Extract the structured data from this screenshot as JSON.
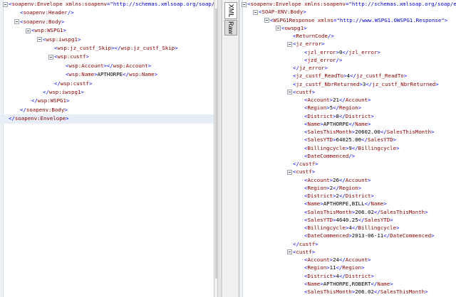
{
  "tabs": {
    "xml": "XML",
    "raw": "Raw"
  },
  "left_lines": [
    {
      "d": 0,
      "f": true,
      "p": [
        [
          "<",
          "p"
        ],
        [
          "soapenv:Envelope",
          "t"
        ],
        [
          " xmlns:soapenv",
          "a"
        ],
        [
          "=",
          "p"
        ],
        [
          "\"http://schemas.xmlsoap.org/soap/envelope/\"",
          "v"
        ],
        [
          ">",
          "p"
        ]
      ]
    },
    {
      "d": 1,
      "f": false,
      "p": [
        [
          "<",
          "p"
        ],
        [
          "soapenv:Header",
          "t"
        ],
        [
          "/>",
          "p"
        ]
      ]
    },
    {
      "d": 1,
      "f": true,
      "p": [
        [
          "<",
          "p"
        ],
        [
          "soapenv:Body",
          "t"
        ],
        [
          ">",
          "p"
        ]
      ]
    },
    {
      "d": 2,
      "f": true,
      "p": [
        [
          "<",
          "p"
        ],
        [
          "wsp:WSPG1",
          "t"
        ],
        [
          ">",
          "p"
        ]
      ]
    },
    {
      "d": 3,
      "f": true,
      "p": [
        [
          "<",
          "p"
        ],
        [
          "wsp:iwspg1",
          "t"
        ],
        [
          ">",
          "p"
        ]
      ]
    },
    {
      "d": 4,
      "f": false,
      "p": [
        [
          "<",
          "p"
        ],
        [
          "wsp:jz_custf_Skip",
          "t"
        ],
        [
          "></",
          "p"
        ],
        [
          "wsp:jz_custf_Skip",
          "t"
        ],
        [
          ">",
          "p"
        ]
      ]
    },
    {
      "d": 4,
      "f": true,
      "p": [
        [
          "<",
          "p"
        ],
        [
          "wsp:custf",
          "t"
        ],
        [
          ">",
          "p"
        ]
      ]
    },
    {
      "d": 5,
      "f": false,
      "p": [
        [
          "<",
          "p"
        ],
        [
          "wsp:Account",
          "t"
        ],
        [
          "></",
          "p"
        ],
        [
          "wsp:Account",
          "t"
        ],
        [
          ">",
          "p"
        ]
      ]
    },
    {
      "d": 5,
      "f": false,
      "p": [
        [
          "<",
          "p"
        ],
        [
          "wsp:Name",
          "t"
        ],
        [
          ">",
          "p"
        ],
        [
          "APTHORPE",
          "x"
        ],
        [
          "</",
          "p"
        ],
        [
          "wsp:Name",
          "t"
        ],
        [
          ">",
          "p"
        ]
      ]
    },
    {
      "d": 4,
      "f": false,
      "p": [
        [
          "</",
          "p"
        ],
        [
          "wsp:custf",
          "t"
        ],
        [
          ">",
          "p"
        ]
      ]
    },
    {
      "d": 3,
      "f": false,
      "p": [
        [
          "</",
          "p"
        ],
        [
          "wsp:iwspg1",
          "t"
        ],
        [
          ">",
          "p"
        ]
      ]
    },
    {
      "d": 2,
      "f": false,
      "p": [
        [
          "</",
          "p"
        ],
        [
          "wsp:WSPG1",
          "t"
        ],
        [
          ">",
          "p"
        ]
      ]
    },
    {
      "d": 1,
      "f": false,
      "p": [
        [
          "</",
          "p"
        ],
        [
          "soapenv:Body",
          "t"
        ],
        [
          ">",
          "p"
        ]
      ]
    },
    {
      "d": 0,
      "f": false,
      "hl": true,
      "p": [
        [
          "</",
          "p"
        ],
        [
          "soapenv:Envelope",
          "t"
        ],
        [
          ">",
          "p"
        ]
      ]
    }
  ],
  "right_lines": [
    {
      "d": 0,
      "f": true,
      "p": [
        [
          "<",
          "p"
        ],
        [
          "soapenv:Envelope",
          "t"
        ],
        [
          " xmlns:soapenv",
          "a"
        ],
        [
          "=",
          "p"
        ],
        [
          "\"http://schemas.xmlsoap.org/soap/envelope/\"",
          "v"
        ],
        [
          ">",
          "p"
        ]
      ]
    },
    {
      "d": 1,
      "f": true,
      "p": [
        [
          "<",
          "p"
        ],
        [
          "SOAP-ENV:Body",
          "t"
        ],
        [
          ">",
          "p"
        ]
      ]
    },
    {
      "d": 2,
      "f": true,
      "p": [
        [
          "<",
          "p"
        ],
        [
          "WSPG1Response",
          "t"
        ],
        [
          " xmlns",
          "a"
        ],
        [
          "=",
          "p"
        ],
        [
          "\"http://www.WSPG1.OWSPG1.Response\"",
          "v"
        ],
        [
          ">",
          "p"
        ]
      ]
    },
    {
      "d": 3,
      "f": true,
      "p": [
        [
          "<",
          "p"
        ],
        [
          "owspg1",
          "t"
        ],
        [
          ">",
          "p"
        ]
      ]
    },
    {
      "d": 4,
      "f": false,
      "p": [
        [
          "<",
          "p"
        ],
        [
          "ReturnCode",
          "t"
        ],
        [
          "/>",
          "p"
        ]
      ]
    },
    {
      "d": 4,
      "f": true,
      "p": [
        [
          "<",
          "p"
        ],
        [
          "jz_error",
          "t"
        ],
        [
          ">",
          "p"
        ]
      ]
    },
    {
      "d": 5,
      "f": false,
      "p": [
        [
          "<",
          "p"
        ],
        [
          "jzl_error",
          "t"
        ],
        [
          ">",
          "p"
        ],
        [
          "0",
          "x"
        ],
        [
          "</",
          "p"
        ],
        [
          "jzl_error",
          "t"
        ],
        [
          ">",
          "p"
        ]
      ]
    },
    {
      "d": 5,
      "f": false,
      "p": [
        [
          "<",
          "p"
        ],
        [
          "jzd_error",
          "t"
        ],
        [
          "/>",
          "p"
        ]
      ]
    },
    {
      "d": 4,
      "f": false,
      "p": [
        [
          "</",
          "p"
        ],
        [
          "jz_error",
          "t"
        ],
        [
          ">",
          "p"
        ]
      ]
    },
    {
      "d": 4,
      "f": false,
      "p": [
        [
          "<",
          "p"
        ],
        [
          "jz_custf_ReadTo",
          "t"
        ],
        [
          ">",
          "p"
        ],
        [
          "4",
          "x"
        ],
        [
          "</",
          "p"
        ],
        [
          "jz_custf_ReadTo",
          "t"
        ],
        [
          ">",
          "p"
        ]
      ]
    },
    {
      "d": 4,
      "f": false,
      "p": [
        [
          "<",
          "p"
        ],
        [
          "jz_custf_NbrReturned",
          "t"
        ],
        [
          ">",
          "p"
        ],
        [
          "3",
          "x"
        ],
        [
          "</",
          "p"
        ],
        [
          "jz_custf_NbrReturned",
          "t"
        ],
        [
          ">",
          "p"
        ]
      ]
    },
    {
      "d": 4,
      "f": true,
      "p": [
        [
          "<",
          "p"
        ],
        [
          "custf",
          "t"
        ],
        [
          ">",
          "p"
        ]
      ]
    },
    {
      "d": 5,
      "f": false,
      "p": [
        [
          "<",
          "p"
        ],
        [
          "Account",
          "t"
        ],
        [
          ">",
          "p"
        ],
        [
          "21",
          "x"
        ],
        [
          "</",
          "p"
        ],
        [
          "Account",
          "t"
        ],
        [
          ">",
          "p"
        ]
      ]
    },
    {
      "d": 5,
      "f": false,
      "p": [
        [
          "<",
          "p"
        ],
        [
          "Region",
          "t"
        ],
        [
          ">",
          "p"
        ],
        [
          "5",
          "x"
        ],
        [
          "</",
          "p"
        ],
        [
          "Region",
          "t"
        ],
        [
          ">",
          "p"
        ]
      ]
    },
    {
      "d": 5,
      "f": false,
      "p": [
        [
          "<",
          "p"
        ],
        [
          "District",
          "t"
        ],
        [
          ">",
          "p"
        ],
        [
          "8",
          "x"
        ],
        [
          "</",
          "p"
        ],
        [
          "District",
          "t"
        ],
        [
          ">",
          "p"
        ]
      ]
    },
    {
      "d": 5,
      "f": false,
      "p": [
        [
          "<",
          "p"
        ],
        [
          "Name",
          "t"
        ],
        [
          ">",
          "p"
        ],
        [
          "APTHORPE",
          "x"
        ],
        [
          "</",
          "p"
        ],
        [
          "Name",
          "t"
        ],
        [
          ">",
          "p"
        ]
      ]
    },
    {
      "d": 5,
      "f": false,
      "p": [
        [
          "<",
          "p"
        ],
        [
          "SalesThisMonth",
          "t"
        ],
        [
          ">",
          "p"
        ],
        [
          "20602.00",
          "x"
        ],
        [
          "</",
          "p"
        ],
        [
          "SalesThisMonth",
          "t"
        ],
        [
          ">",
          "p"
        ]
      ]
    },
    {
      "d": 5,
      "f": false,
      "p": [
        [
          "<",
          "p"
        ],
        [
          "SalesYTD",
          "t"
        ],
        [
          ">",
          "p"
        ],
        [
          "64025.00",
          "x"
        ],
        [
          "</",
          "p"
        ],
        [
          "SalesYTD",
          "t"
        ],
        [
          ">",
          "p"
        ]
      ]
    },
    {
      "d": 5,
      "f": false,
      "p": [
        [
          "<",
          "p"
        ],
        [
          "Billingcycle",
          "t"
        ],
        [
          ">",
          "p"
        ],
        [
          "9",
          "x"
        ],
        [
          "</",
          "p"
        ],
        [
          "Billingcycle",
          "t"
        ],
        [
          ">",
          "p"
        ]
      ]
    },
    {
      "d": 5,
      "f": false,
      "p": [
        [
          "<",
          "p"
        ],
        [
          "DateCommenced",
          "t"
        ],
        [
          "/>",
          "p"
        ]
      ]
    },
    {
      "d": 4,
      "f": false,
      "p": [
        [
          "</",
          "p"
        ],
        [
          "custf",
          "t"
        ],
        [
          ">",
          "p"
        ]
      ]
    },
    {
      "d": 4,
      "f": true,
      "p": [
        [
          "<",
          "p"
        ],
        [
          "custf",
          "t"
        ],
        [
          ">",
          "p"
        ]
      ]
    },
    {
      "d": 5,
      "f": false,
      "p": [
        [
          "<",
          "p"
        ],
        [
          "Account",
          "t"
        ],
        [
          ">",
          "p"
        ],
        [
          "26",
          "x"
        ],
        [
          "</",
          "p"
        ],
        [
          "Account",
          "t"
        ],
        [
          ">",
          "p"
        ]
      ]
    },
    {
      "d": 5,
      "f": false,
      "p": [
        [
          "<",
          "p"
        ],
        [
          "Region",
          "t"
        ],
        [
          ">",
          "p"
        ],
        [
          "2",
          "x"
        ],
        [
          "</",
          "p"
        ],
        [
          "Region",
          "t"
        ],
        [
          ">",
          "p"
        ]
      ]
    },
    {
      "d": 5,
      "f": false,
      "p": [
        [
          "<",
          "p"
        ],
        [
          "District",
          "t"
        ],
        [
          ">",
          "p"
        ],
        [
          "2",
          "x"
        ],
        [
          "</",
          "p"
        ],
        [
          "District",
          "t"
        ],
        [
          ">",
          "p"
        ]
      ]
    },
    {
      "d": 5,
      "f": false,
      "p": [
        [
          "<",
          "p"
        ],
        [
          "Name",
          "t"
        ],
        [
          ">",
          "p"
        ],
        [
          "APTHORPE,BILL",
          "x"
        ],
        [
          "</",
          "p"
        ],
        [
          "Name",
          "t"
        ],
        [
          ">",
          "p"
        ]
      ]
    },
    {
      "d": 5,
      "f": false,
      "p": [
        [
          "<",
          "p"
        ],
        [
          "SalesThisMonth",
          "t"
        ],
        [
          ">",
          "p"
        ],
        [
          "206.02",
          "x"
        ],
        [
          "</",
          "p"
        ],
        [
          "SalesThisMonth",
          "t"
        ],
        [
          ">",
          "p"
        ]
      ]
    },
    {
      "d": 5,
      "f": false,
      "p": [
        [
          "<",
          "p"
        ],
        [
          "SalesYTD",
          "t"
        ],
        [
          ">",
          "p"
        ],
        [
          "4640.25",
          "x"
        ],
        [
          "</",
          "p"
        ],
        [
          "SalesYTD",
          "t"
        ],
        [
          ">",
          "p"
        ]
      ]
    },
    {
      "d": 5,
      "f": false,
      "p": [
        [
          "<",
          "p"
        ],
        [
          "Billingcycle",
          "t"
        ],
        [
          ">",
          "p"
        ],
        [
          "4",
          "x"
        ],
        [
          "</",
          "p"
        ],
        [
          "Billingcycle",
          "t"
        ],
        [
          ">",
          "p"
        ]
      ]
    },
    {
      "d": 5,
      "f": false,
      "p": [
        [
          "<",
          "p"
        ],
        [
          "DateCommenced",
          "t"
        ],
        [
          ">",
          "p"
        ],
        [
          "2013-06-11",
          "x"
        ],
        [
          "</",
          "p"
        ],
        [
          "DateCommenced",
          "t"
        ],
        [
          ">",
          "p"
        ]
      ]
    },
    {
      "d": 4,
      "f": false,
      "p": [
        [
          "</",
          "p"
        ],
        [
          "custf",
          "t"
        ],
        [
          ">",
          "p"
        ]
      ]
    },
    {
      "d": 4,
      "f": true,
      "p": [
        [
          "<",
          "p"
        ],
        [
          "custf",
          "t"
        ],
        [
          ">",
          "p"
        ]
      ]
    },
    {
      "d": 5,
      "f": false,
      "p": [
        [
          "<",
          "p"
        ],
        [
          "Account",
          "t"
        ],
        [
          ">",
          "p"
        ],
        [
          "24",
          "x"
        ],
        [
          "</",
          "p"
        ],
        [
          "Account",
          "t"
        ],
        [
          ">",
          "p"
        ]
      ]
    },
    {
      "d": 5,
      "f": false,
      "p": [
        [
          "<",
          "p"
        ],
        [
          "Region",
          "t"
        ],
        [
          ">",
          "p"
        ],
        [
          "11",
          "x"
        ],
        [
          "</",
          "p"
        ],
        [
          "Region",
          "t"
        ],
        [
          ">",
          "p"
        ]
      ]
    },
    {
      "d": 5,
      "f": false,
      "p": [
        [
          "<",
          "p"
        ],
        [
          "District",
          "t"
        ],
        [
          ">",
          "p"
        ],
        [
          "4",
          "x"
        ],
        [
          "</",
          "p"
        ],
        [
          "District",
          "t"
        ],
        [
          ">",
          "p"
        ]
      ]
    },
    {
      "d": 5,
      "f": false,
      "p": [
        [
          "<",
          "p"
        ],
        [
          "Name",
          "t"
        ],
        [
          ">",
          "p"
        ],
        [
          "APTHORPE,ROBERT",
          "x"
        ],
        [
          "</",
          "p"
        ],
        [
          "Name",
          "t"
        ],
        [
          ">",
          "p"
        ]
      ]
    },
    {
      "d": 5,
      "f": false,
      "p": [
        [
          "<",
          "p"
        ],
        [
          "SalesThisMonth",
          "t"
        ],
        [
          ">",
          "p"
        ],
        [
          "206.02",
          "x"
        ],
        [
          "</",
          "p"
        ],
        [
          "SalesThisMonth",
          "t"
        ],
        [
          ">",
          "p"
        ]
      ]
    }
  ]
}
